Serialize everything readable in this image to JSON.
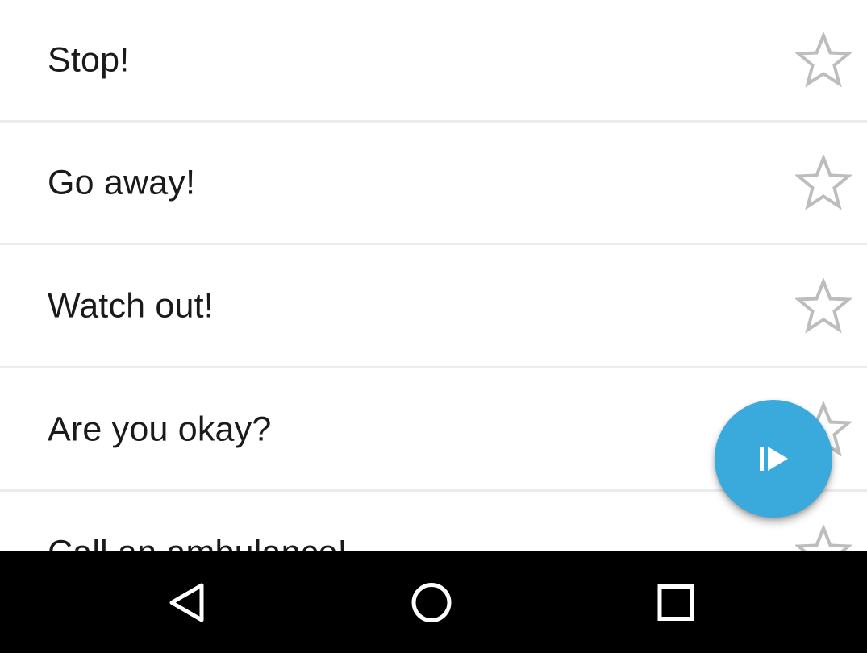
{
  "phrases": [
    {
      "label": "Stop!",
      "favorite": false,
      "icon": "star-outline-icon"
    },
    {
      "label": "Go away!",
      "favorite": false,
      "icon": "star-outline-icon"
    },
    {
      "label": "Watch out!",
      "favorite": false,
      "icon": "star-outline-icon"
    },
    {
      "label": "Are you okay?",
      "favorite": false,
      "icon": "star-outline-icon"
    },
    {
      "label": "Call an ambulance!",
      "favorite": false,
      "icon": "star-outline-icon"
    }
  ],
  "fab": {
    "icon": "play-icon",
    "color": "#3aa9dc"
  },
  "nav": {
    "back_icon": "back-triangle-icon",
    "home_icon": "home-circle-icon",
    "recents_icon": "recents-square-icon"
  },
  "colors": {
    "star": "#bdbdbd",
    "divider": "#ececec",
    "text": "#1a1a1a"
  }
}
